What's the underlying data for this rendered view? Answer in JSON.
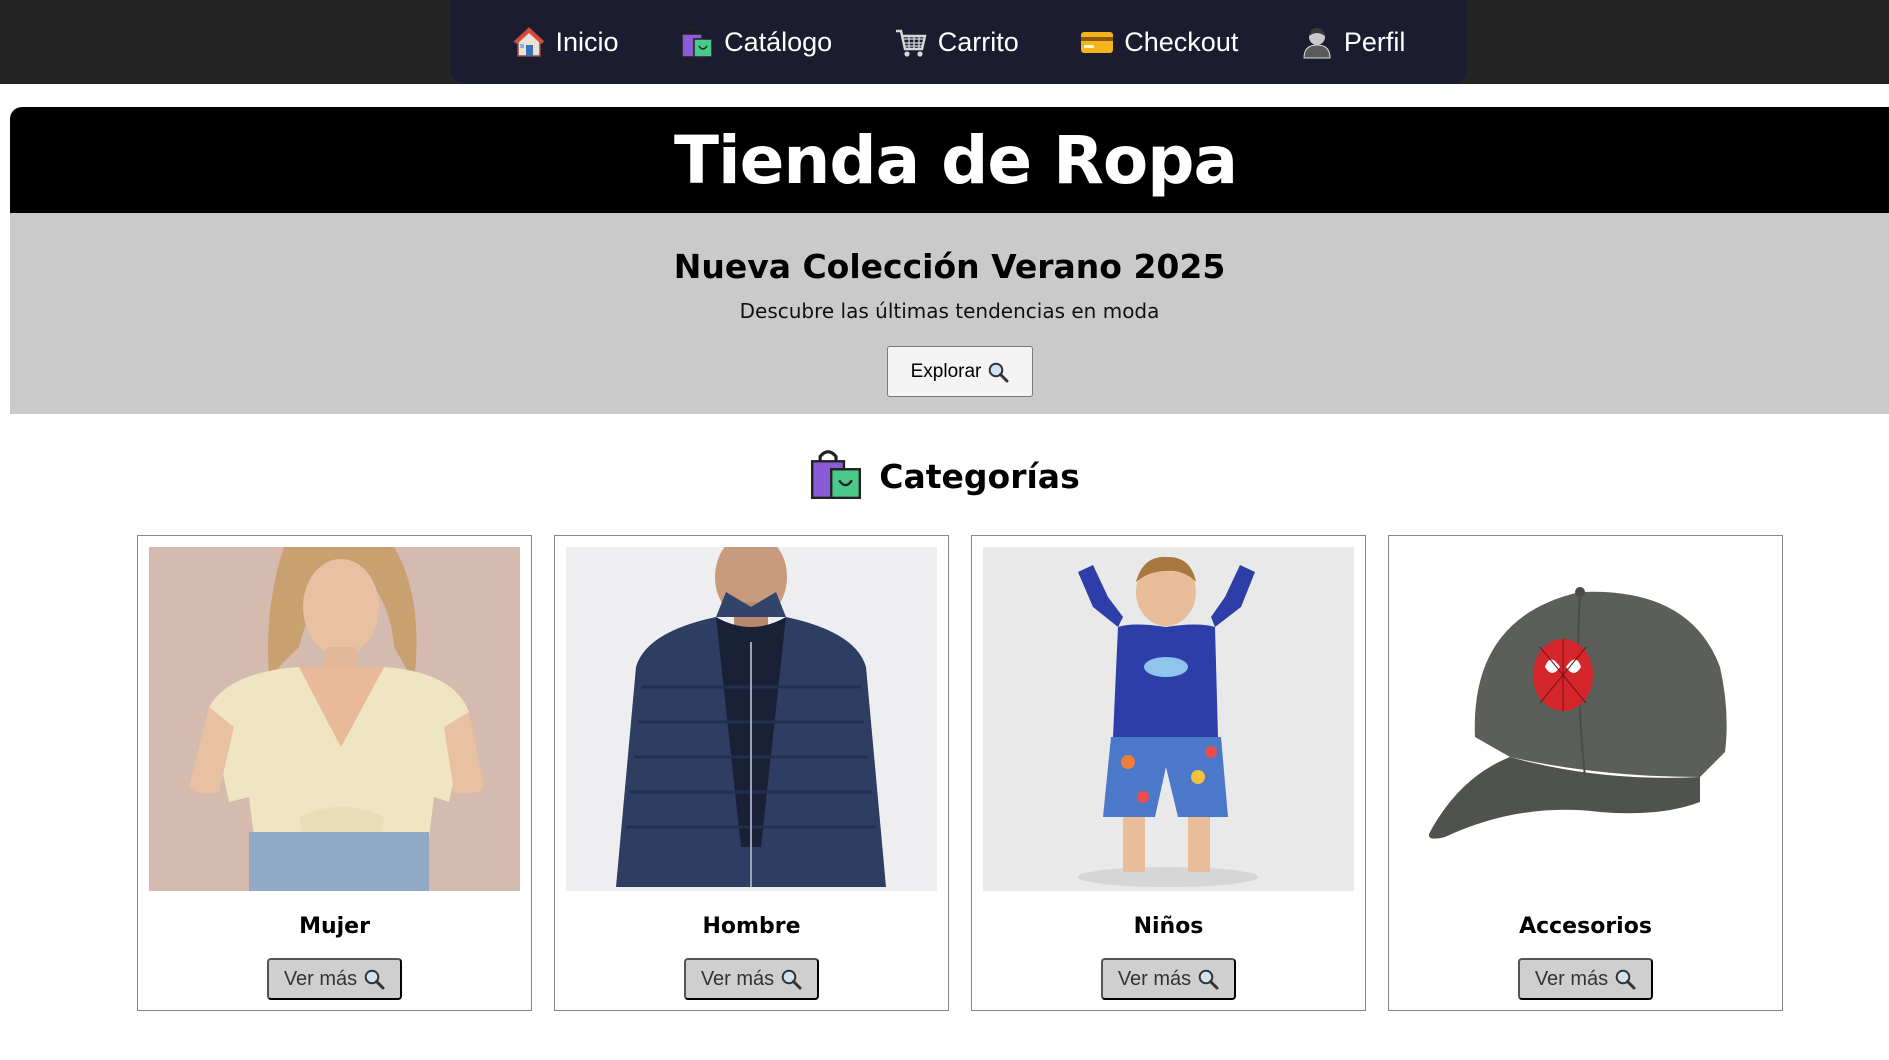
{
  "nav": {
    "items": [
      {
        "label": "Inicio",
        "icon": "house-icon"
      },
      {
        "label": "Catálogo",
        "icon": "shopping-bags-icon"
      },
      {
        "label": "Carrito",
        "icon": "shopping-cart-icon"
      },
      {
        "label": "Checkout",
        "icon": "credit-card-icon"
      },
      {
        "label": "Perfil",
        "icon": "user-icon"
      }
    ]
  },
  "hero": {
    "title": "Tienda de Ropa",
    "banner_title": "Nueva Colección Verano 2025",
    "banner_subtitle": "Descubre las últimas tendencias en moda",
    "explore_label": "Explorar"
  },
  "categories": {
    "heading": "Categorías",
    "heading_icon": "shopping-bags-icon",
    "items": [
      {
        "name": "Mujer",
        "button_label": "Ver más",
        "image": "woman-blouse-photo"
      },
      {
        "name": "Hombre",
        "button_label": "Ver más",
        "image": "man-jacket-photo"
      },
      {
        "name": "Niños",
        "button_label": "Ver más",
        "image": "kid-swimwear-photo"
      },
      {
        "name": "Accesorios",
        "button_label": "Ver más",
        "image": "cap-photo"
      }
    ]
  },
  "colors": {
    "topbar": "#242424",
    "nav_bg": "#1b1c30",
    "hero_band": "#000000",
    "banner_bg": "#cacaca",
    "card_button_bg": "#cfcfcf"
  }
}
